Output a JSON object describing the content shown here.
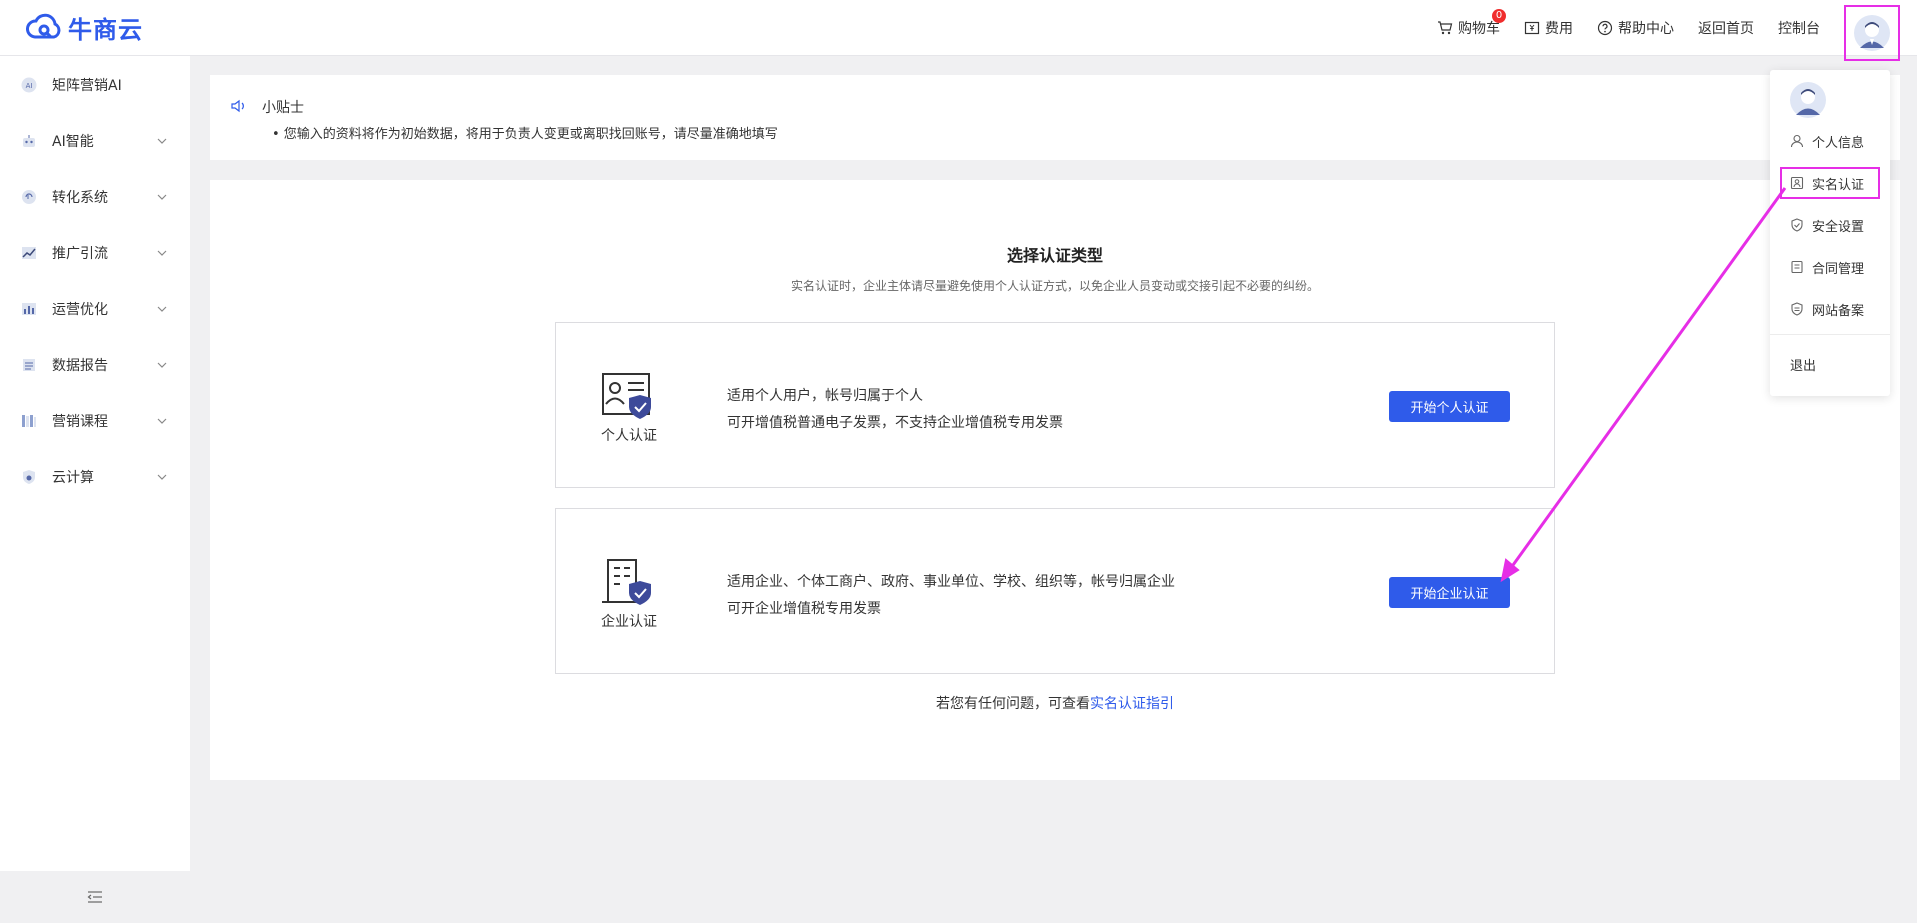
{
  "brand": {
    "name": "牛商云",
    "color": "#2f5bea"
  },
  "header": {
    "cart_label": "购物车",
    "cart_count": "0",
    "fee_label": "费用",
    "help_label": "帮助中心",
    "home_label": "返回首页",
    "console_label": "控制台"
  },
  "sidebar": {
    "items": [
      {
        "label": "矩阵营销AI",
        "icon": "ai-icon"
      },
      {
        "label": "AI智能",
        "icon": "robot-icon"
      },
      {
        "label": "转化系统",
        "icon": "conversion-icon"
      },
      {
        "label": "推广引流",
        "icon": "trend-icon"
      },
      {
        "label": "运营优化",
        "icon": "bar-chart-icon"
      },
      {
        "label": "数据报告",
        "icon": "report-icon"
      },
      {
        "label": "营销课程",
        "icon": "books-icon"
      },
      {
        "label": "云计算",
        "icon": "cloud-shield-icon"
      }
    ]
  },
  "tip": {
    "title": "小贴士",
    "text": "• 您输入的资料将作为初始数据，将用于负责人变更或离职找回账号，请尽量准确地填写"
  },
  "main": {
    "title": "选择认证类型",
    "subtitle": "实名认证时，企业主体请尽量避免使用个人认证方式，以免企业人员变动或交接引起不必要的纠纷。",
    "personal": {
      "label": "个人认证",
      "line1": "适用个人用户，帐号归属于个人",
      "line2": "可开增值税普通电子发票，不支持企业增值税专用发票",
      "button": "开始个人认证"
    },
    "enterprise": {
      "label": "企业认证",
      "line1": "适用企业、个体工商户、政府、事业单位、学校、组织等，帐号归属企业",
      "line2": "可开企业增值税专用发票",
      "button": "开始企业认证"
    },
    "help_prefix": "若您有任何问题，可查看",
    "help_link": "实名认证指引"
  },
  "dropdown": {
    "items": [
      {
        "label": "个人信息",
        "icon": "user-icon"
      },
      {
        "label": "实名认证",
        "icon": "id-card-icon"
      },
      {
        "label": "安全设置",
        "icon": "shield-icon"
      },
      {
        "label": "合同管理",
        "icon": "contract-icon"
      },
      {
        "label": "网站备案",
        "icon": "filing-icon"
      }
    ],
    "logout": "退出"
  },
  "annotation_color": "#e62ee6"
}
